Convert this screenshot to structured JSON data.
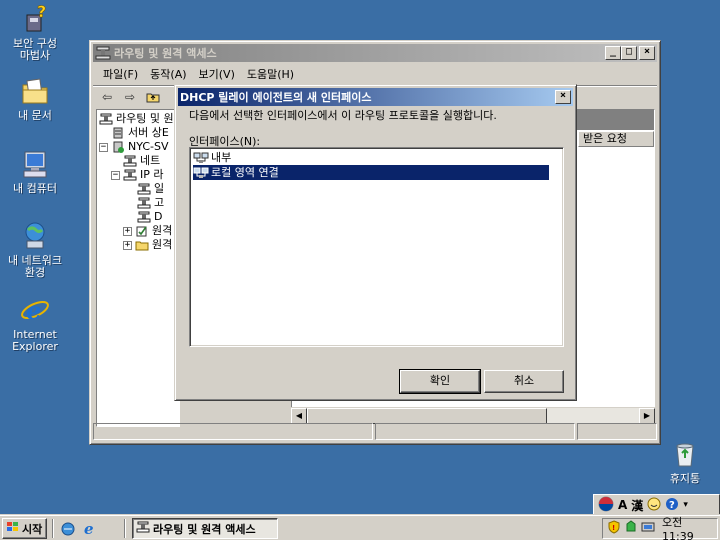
{
  "desktop": {
    "icons": [
      {
        "label_line1": "보안 구성",
        "label_line2": "마법사",
        "icon": "security-wizard-icon"
      },
      {
        "label_line1": "내 문서",
        "label_line2": "",
        "icon": "my-documents-icon"
      },
      {
        "label_line1": "내 컴퓨터",
        "label_line2": "",
        "icon": "my-computer-icon"
      },
      {
        "label_line1": "내 네트워크",
        "label_line2": "환경",
        "icon": "my-network-icon"
      },
      {
        "label_line1": "Internet",
        "label_line2": "Explorer",
        "icon": "internet-explorer-icon"
      },
      {
        "label_line1": "휴지통",
        "label_line2": "",
        "icon": "recycle-bin-icon"
      }
    ]
  },
  "main_window": {
    "title": "라우팅 및 원격 액세스",
    "menu": [
      "파일(F)",
      "동작(A)",
      "보기(V)",
      "도움말(H)"
    ],
    "tree": [
      {
        "label": "라우팅 및 원",
        "level": 0
      },
      {
        "label": "서버 상E",
        "level": 1
      },
      {
        "label": "NYC-SV",
        "level": 1
      },
      {
        "label": "네트",
        "level": 2
      },
      {
        "label": "IP 라",
        "level": 2
      },
      {
        "label": "일",
        "level": 3
      },
      {
        "label": "고",
        "level": 3
      },
      {
        "label": "D",
        "level": 3
      },
      {
        "label": "원격",
        "level": 2
      },
      {
        "label": "원격",
        "level": 2
      }
    ],
    "column_header": "받은 요청"
  },
  "dialog": {
    "title": "DHCP 릴레이 에이전트의 새 인터페이스",
    "instruction": "다음에서 선택한 인터페이스에서 이 라우팅 프로토콜을 실행합니다.",
    "list_label": "인터페이스(N):",
    "interfaces": [
      {
        "name": "내부",
        "selected": false
      },
      {
        "name": "로컬 영역 연결",
        "selected": true
      }
    ],
    "ok_label": "확인",
    "cancel_label": "취소"
  },
  "langbar": {
    "lang": "A",
    "hanja": "漢"
  },
  "taskbar": {
    "start_label": "시작",
    "task_label": "라우팅 및 원격 액세스",
    "clock": "오전 11:39"
  },
  "colors": {
    "desktop": "#3a6ea5",
    "title_active": "#0a246a",
    "title_inactive": "#808080",
    "selection": "#0a246a"
  }
}
